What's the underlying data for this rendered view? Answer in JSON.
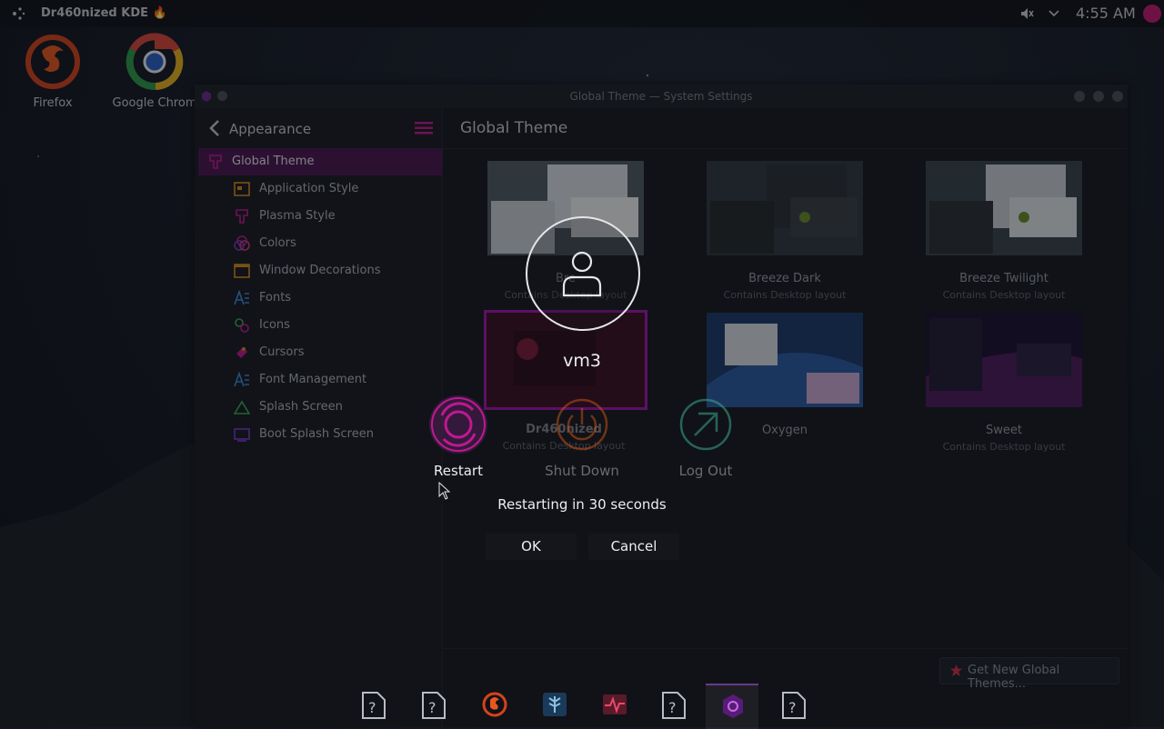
{
  "panel": {
    "title": "Dr460nized KDE 🔥",
    "clock": "4:55 AM",
    "icons": [
      "app-launcher-icon",
      "volume-muted-icon",
      "chevron-down-icon",
      "user-avatar"
    ]
  },
  "desktop": {
    "icons": [
      {
        "label": "Firefox",
        "icon": "firefox-icon"
      },
      {
        "label": "Google Chrom",
        "icon": "chrome-icon"
      }
    ]
  },
  "window": {
    "title": "Global Theme — System Settings",
    "sidebar": {
      "back_label": "Appearance",
      "items": [
        {
          "label": "Global Theme",
          "icon": "global-theme-icon",
          "selected": true
        },
        {
          "label": "Application Style",
          "icon": "application-style-icon"
        },
        {
          "label": "Plasma Style",
          "icon": "plasma-style-icon"
        },
        {
          "label": "Colors",
          "icon": "colors-icon"
        },
        {
          "label": "Window Decorations",
          "icon": "window-decorations-icon"
        },
        {
          "label": "Fonts",
          "icon": "fonts-icon"
        },
        {
          "label": "Icons",
          "icon": "icons-icon"
        },
        {
          "label": "Cursors",
          "icon": "cursors-icon"
        },
        {
          "label": "Font Management",
          "icon": "font-management-icon"
        },
        {
          "label": "Splash Screen",
          "icon": "splash-screen-icon"
        },
        {
          "label": "Boot Splash Screen",
          "icon": "boot-splash-screen-icon"
        }
      ]
    },
    "content_title": "Global Theme",
    "themes": [
      {
        "name": "Bre",
        "desc": "Contains Desktop layout"
      },
      {
        "name": "Breeze Dark",
        "desc": "Contains Desktop layout"
      },
      {
        "name": "Breeze Twilight",
        "desc": "Contains Desktop layout"
      },
      {
        "name": "Dr460nized",
        "desc": "Contains Desktop layout",
        "selected": true
      },
      {
        "name": "Oxygen",
        "desc": ""
      },
      {
        "name": "Sweet",
        "desc": "Contains Desktop layout"
      }
    ],
    "get_new_label": "Get New Global Themes..."
  },
  "logout_dialog": {
    "username": "vm3",
    "actions": [
      {
        "label": "Restart",
        "icon": "restart-icon",
        "selected": true
      },
      {
        "label": "Shut Down",
        "icon": "power-icon"
      },
      {
        "label": "Log Out",
        "icon": "logout-icon"
      }
    ],
    "countdown": "Restarting in 30 seconds",
    "ok_label": "OK",
    "cancel_label": "Cancel"
  },
  "taskbar": {
    "items": [
      "unknown-app-icon",
      "unknown-app-icon",
      "firefox-icon",
      "tree-app-icon",
      "system-monitor-icon",
      "unknown-app-icon",
      "system-settings-icon",
      "unknown-app-icon"
    ],
    "active_index": 6
  },
  "colors": {
    "accent": "#a014b0",
    "selection": "#4a1450",
    "avatar": "#c21873"
  }
}
